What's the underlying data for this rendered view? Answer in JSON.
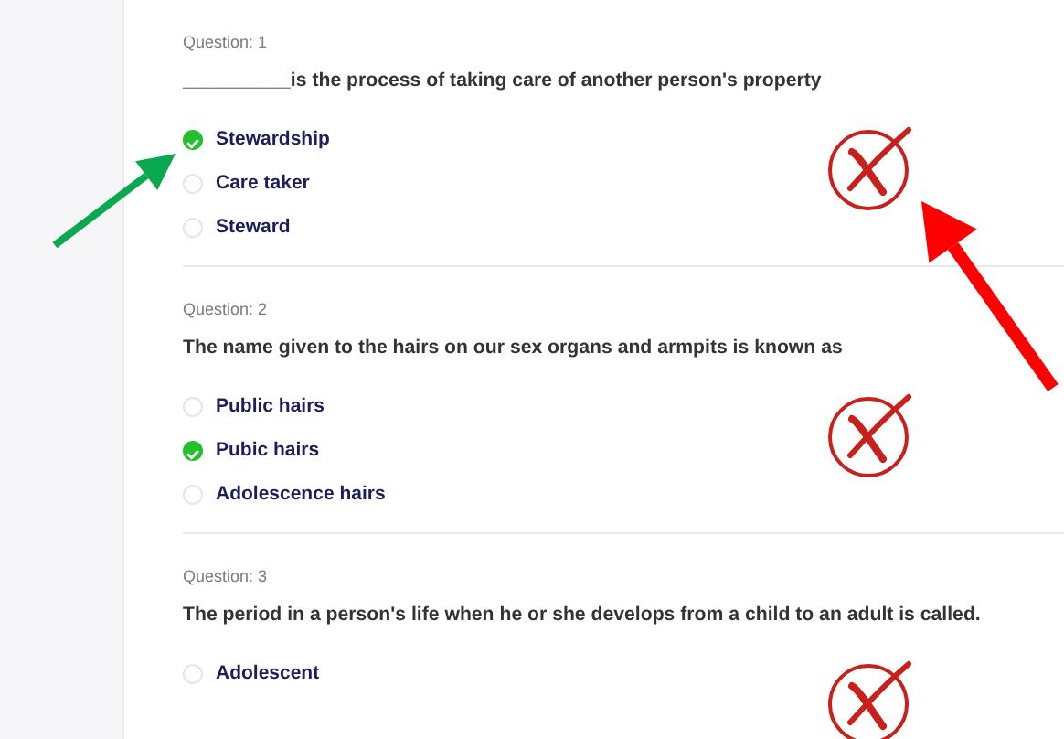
{
  "questions": [
    {
      "label": "Question: 1",
      "text": "__________is the process of taking care of another person's property",
      "correct": false,
      "options": [
        {
          "text": "Stewardship",
          "selected": true
        },
        {
          "text": "Care taker",
          "selected": false
        },
        {
          "text": "Steward",
          "selected": false
        }
      ]
    },
    {
      "label": "Question: 2",
      "text": "The name given to the hairs on our sex organs and armpits is known as",
      "correct": false,
      "options": [
        {
          "text": "Public hairs",
          "selected": false
        },
        {
          "text": "Pubic hairs",
          "selected": true
        },
        {
          "text": "Adolescence hairs",
          "selected": false
        }
      ]
    },
    {
      "label": "Question: 3",
      "text": "The period in a person's life when he or she develops from a child to an adult is called.",
      "correct": false,
      "options": [
        {
          "text": "Adolescent",
          "selected": false
        }
      ]
    }
  ],
  "annotations": [
    {
      "kind": "arrow",
      "color": "#0aa84f"
    },
    {
      "kind": "arrow",
      "color": "#ff0000"
    }
  ]
}
